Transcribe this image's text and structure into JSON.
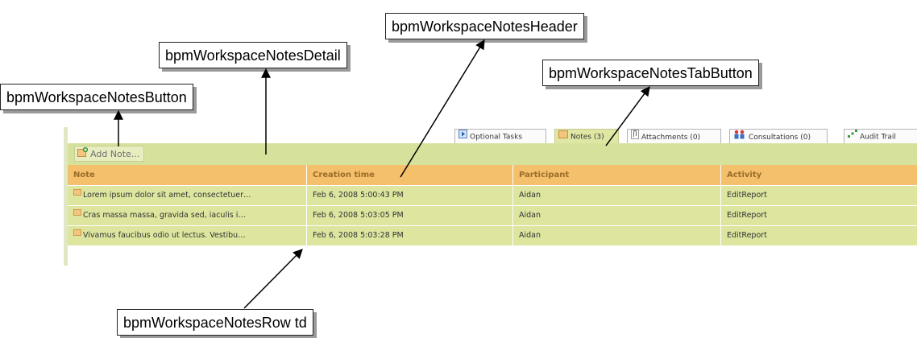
{
  "callouts": {
    "notes_button": "bpmWorkspaceNotesButton",
    "notes_detail": "bpmWorkspaceNotesDetail",
    "notes_header": "bpmWorkspaceNotesHeader",
    "notes_tab_button": "bpmWorkspaceNotesTabButton",
    "notes_row_td": "bpmWorkspaceNotesRow td"
  },
  "tabs": [
    {
      "label": "Optional Tasks",
      "icon": "play-icon"
    },
    {
      "label": "Notes (3)",
      "icon": "note-icon"
    },
    {
      "label": "Attachments (0)",
      "icon": "paperclip-icon"
    },
    {
      "label": "Consultations (0)",
      "icon": "people-icon"
    },
    {
      "label": "Audit Trail",
      "icon": "audit-icon"
    }
  ],
  "toolbar": {
    "add_note_label": "Add Note..."
  },
  "table": {
    "headers": [
      "Note",
      "Creation time",
      "Participant",
      "Activity"
    ],
    "rows": [
      [
        "Lorem ipsum dolor sit amet, consectetuer…",
        "Feb 6, 2008 5:00:43 PM",
        "Aidan",
        "EditReport"
      ],
      [
        "Cras massa massa, gravida sed, iaculis i…",
        "Feb 6, 2008 5:03:05 PM",
        "Aidan",
        "EditReport"
      ],
      [
        "Vivamus faucibus odio ut lectus. Vestibu…",
        "Feb 6, 2008 5:03:28 PM",
        "Aidan",
        "EditReport"
      ]
    ]
  },
  "colors": {
    "toolbar_bg": "#d6e29c",
    "header_bg": "#f5c06b",
    "row_bg": "#dde59f",
    "active_tab_bg": "#e0e7a4"
  }
}
